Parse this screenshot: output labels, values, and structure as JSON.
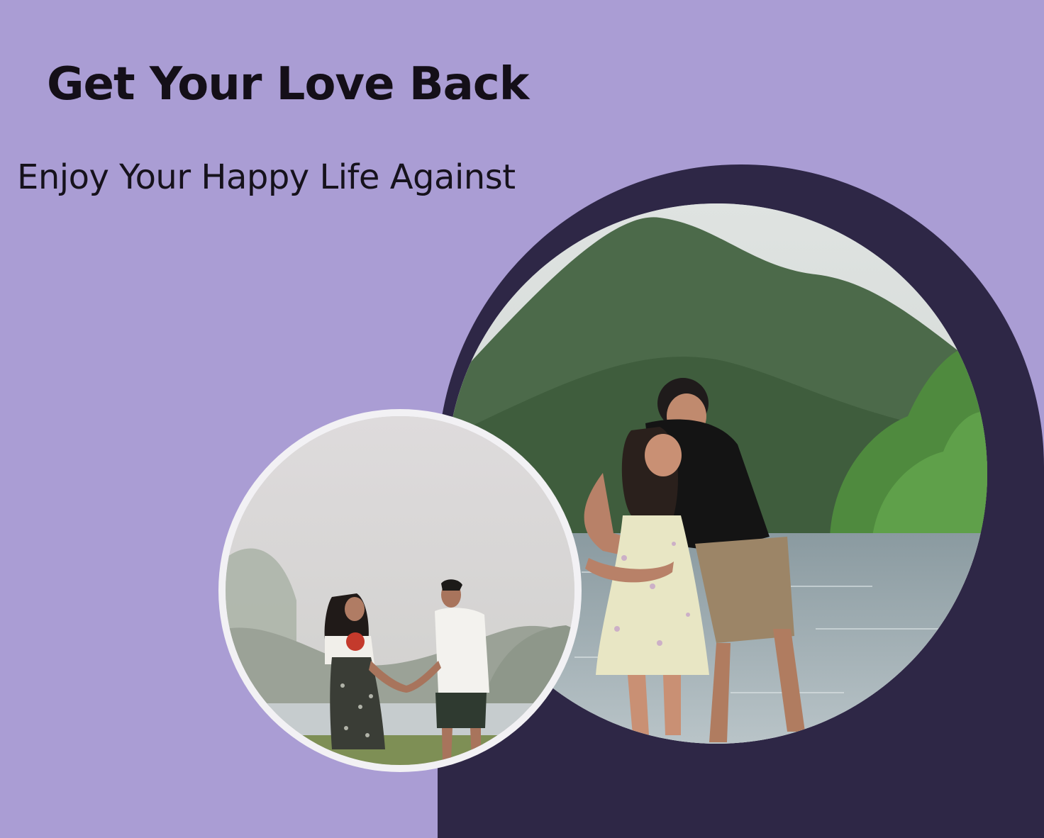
{
  "hero": {
    "title": "Get Your Love Back",
    "subtitle": "Enjoy Your Happy Life Against"
  },
  "colors": {
    "background": "#aa9dd4",
    "arch": "#2e2746",
    "title_text": "#140f18",
    "photo_frame": "#f2f1f4"
  },
  "images": {
    "large": "couple-embracing-by-lake-photo",
    "small": "couple-holding-hands-with-flowers-photo"
  }
}
